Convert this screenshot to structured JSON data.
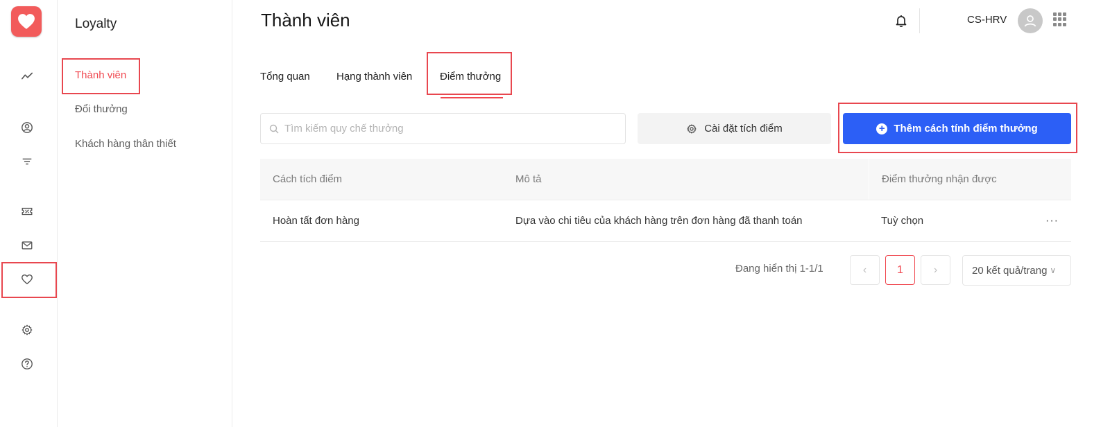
{
  "rail": {
    "items": [
      {
        "icon": "chart-line-icon"
      },
      {
        "icon": "user-circle-icon"
      },
      {
        "icon": "filter-icon"
      },
      {
        "icon": "ticket-icon"
      },
      {
        "icon": "mail-icon"
      },
      {
        "icon": "heart-icon"
      },
      {
        "icon": "gear-icon"
      },
      {
        "icon": "help-icon"
      }
    ]
  },
  "subnav": {
    "title": "Loyalty",
    "items": [
      {
        "label": "Thành viên",
        "active": true
      },
      {
        "label": "Đổi thưởng",
        "active": false
      },
      {
        "label": "Khách hàng thân thiết",
        "active": false
      }
    ]
  },
  "header": {
    "title": "Thành viên",
    "username": "CS-HRV"
  },
  "tabs": [
    {
      "label": "Tổng quan"
    },
    {
      "label": "Hạng thành viên"
    },
    {
      "label": "Điểm thưởng",
      "active": true
    }
  ],
  "toolbar": {
    "search_placeholder": "Tìm kiếm quy chế thưởng",
    "settings_label": "Cài đặt tích điểm",
    "add_label": "Thêm cách tính điểm thưởng"
  },
  "table": {
    "columns": [
      "Cách tích điểm",
      "Mô tả",
      "Điểm thưởng nhận được"
    ],
    "rows": [
      [
        "Hoàn tất đơn hàng",
        "Dựa vào chi tiêu của khách hàng trên đơn hàng đã thanh toán",
        "Tuỳ chọn"
      ]
    ],
    "row_menu": "···"
  },
  "pagination": {
    "info": "Đang hiển thị 1-1/1",
    "prev": "‹",
    "current": "1",
    "next": "›",
    "page_size": "20 kết quả/trang"
  },
  "colors": {
    "accent": "#f0474f",
    "primary": "#2c5ff6",
    "logo": "#f25b5b",
    "annotation": "#e8474f"
  }
}
